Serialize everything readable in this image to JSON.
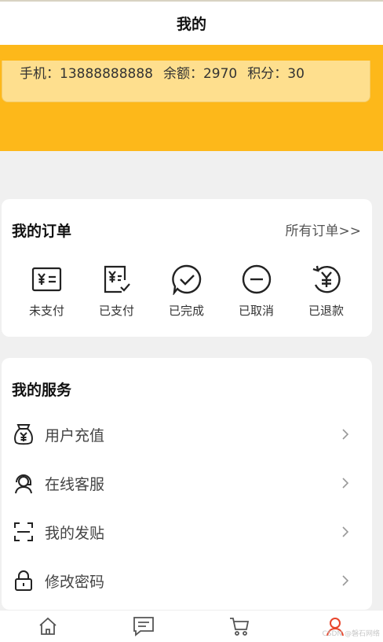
{
  "header": {
    "title": "我的"
  },
  "user": {
    "phone": "手机：13888888888",
    "balance": "余额：2970",
    "points": "积分：30"
  },
  "orders": {
    "title": "我的订单",
    "all_link": "所有订单>>",
    "items": [
      {
        "label": "未支付",
        "icon": "yuan-bill-icon"
      },
      {
        "label": "已支付",
        "icon": "yuan-receipt-check-icon"
      },
      {
        "label": "已完成",
        "icon": "check-chat-icon"
      },
      {
        "label": "已取消",
        "icon": "minus-circle-icon"
      },
      {
        "label": "已退款",
        "icon": "yuan-refund-icon"
      }
    ]
  },
  "services": {
    "title": "我的服务",
    "items": [
      {
        "label": "用户充值",
        "icon": "money-bag-icon"
      },
      {
        "label": "在线客服",
        "icon": "headset-agent-icon"
      },
      {
        "label": "我的发贴",
        "icon": "scan-frame-icon"
      },
      {
        "label": "修改密码",
        "icon": "lock-icon"
      }
    ]
  },
  "tabbar": {
    "items": [
      {
        "icon": "home-icon",
        "active": false
      },
      {
        "icon": "message-icon",
        "active": false
      },
      {
        "icon": "cart-icon",
        "active": false
      },
      {
        "icon": "user-icon",
        "active": true
      }
    ]
  },
  "watermark": "CSDN @磐石网络",
  "colors": {
    "accent": "#fdb81a",
    "card_bg": "#fedf8e",
    "active_tab": "#e8452c"
  }
}
